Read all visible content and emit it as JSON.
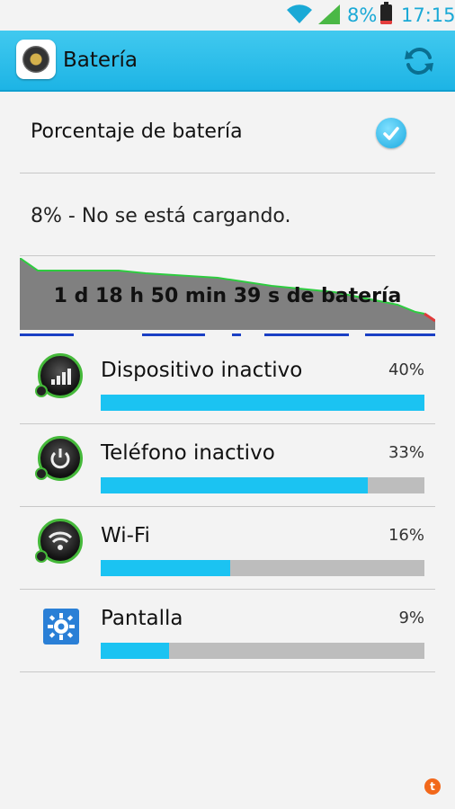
{
  "status_bar": {
    "battery_percent": "8%",
    "time": "17:15",
    "icons": [
      "wifi-icon",
      "signal-icon",
      "battery-icon"
    ]
  },
  "action_bar": {
    "title": "Batería",
    "app_icon": "battery-app-icon",
    "refresh_icon": "refresh-icon"
  },
  "settings": {
    "battery_percentage_label": "Porcentaje de batería",
    "battery_percentage_checked": true
  },
  "battery_status": "8% - No se está cargando.",
  "graph": {
    "label": "1 d 18 h 50 min 39 s de batería"
  },
  "usage_items": [
    {
      "name": "Dispositivo inactivo",
      "percent_label": "40%",
      "fill": 1.0,
      "icon": "signal-bars-icon"
    },
    {
      "name": "Teléfono inactivo",
      "percent_label": "33%",
      "fill": 0.825,
      "icon": "power-icon"
    },
    {
      "name": "Wi-Fi",
      "percent_label": "16%",
      "fill": 0.4,
      "icon": "wifi-icon"
    },
    {
      "name": "Pantalla",
      "percent_label": "9%",
      "fill": 0.21,
      "icon": "settings-gear-icon"
    }
  ],
  "colors": {
    "accent": "#1db4e5",
    "bar_fill": "#1bc3f2",
    "bar_track": "#bdbdbd",
    "graph_fill": "#808080",
    "graph_line": "#2ecc40"
  }
}
